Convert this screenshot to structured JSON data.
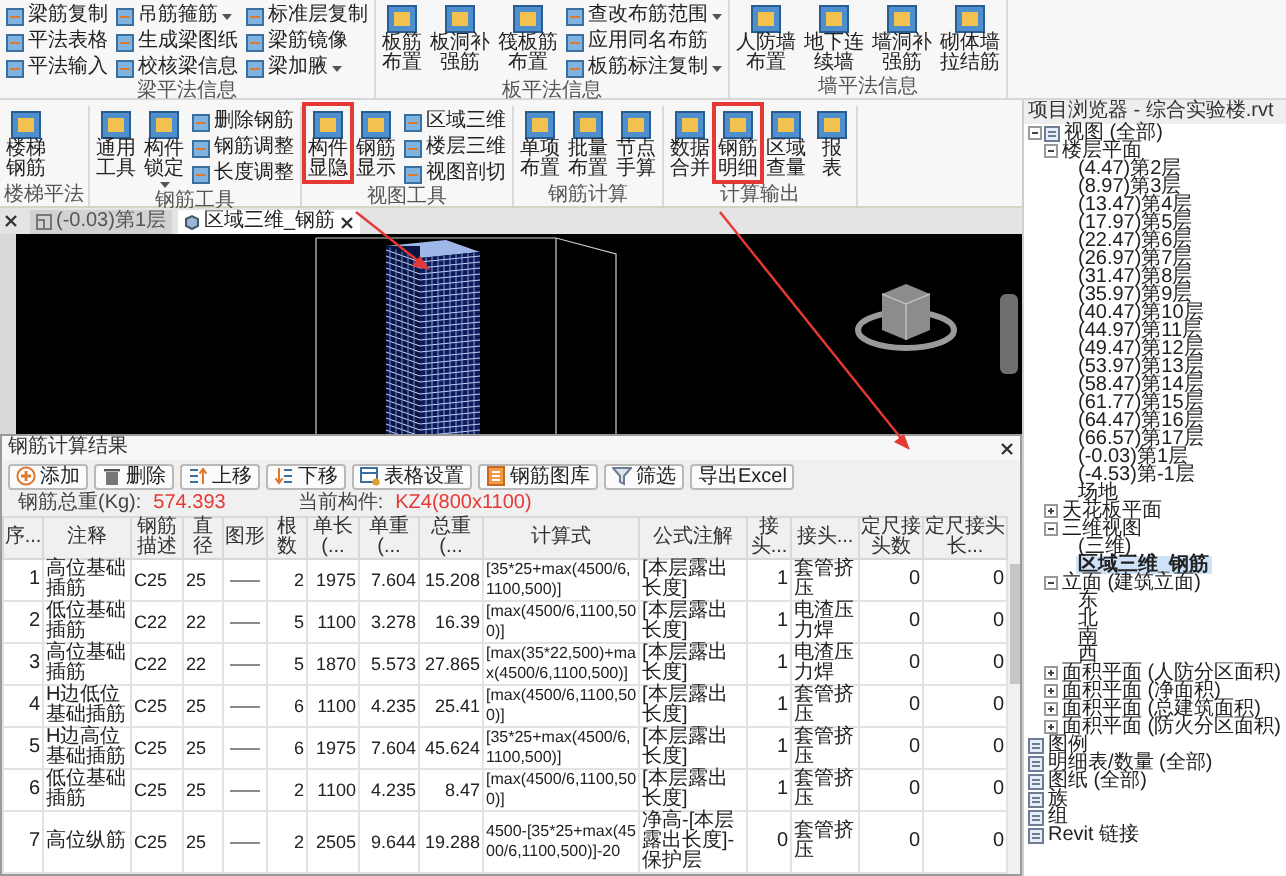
{
  "ribbon": {
    "groups": [
      {
        "label": "梁平法信息",
        "items": [
          {
            "label": "梁筋复制",
            "kind": "small",
            "dropdown": false,
            "highlighted": false
          },
          {
            "label": "平法表格",
            "kind": "small",
            "dropdown": false,
            "highlighted": false
          },
          {
            "label": "平法输入",
            "kind": "small",
            "dropdown": false,
            "highlighted": false
          },
          {
            "label": "吊筋箍筋",
            "kind": "small",
            "dropdown": true,
            "highlighted": false
          },
          {
            "label": "生成梁图纸",
            "kind": "small",
            "dropdown": false,
            "highlighted": false
          },
          {
            "label": "校核梁信息",
            "kind": "small",
            "dropdown": false,
            "highlighted": false
          },
          {
            "label": "标准层复制",
            "kind": "small",
            "dropdown": false,
            "highlighted": false
          },
          {
            "label": "梁筋镜像",
            "kind": "small",
            "dropdown": false,
            "highlighted": false
          },
          {
            "label": "梁加腋",
            "kind": "small",
            "dropdown": true,
            "highlighted": false
          }
        ]
      },
      {
        "label": "板平法信息",
        "items": [
          {
            "label": "板筋布置",
            "kind": "large",
            "dropdown": false,
            "highlighted": false
          },
          {
            "label": "板洞补强筋",
            "kind": "large",
            "dropdown": false,
            "highlighted": false
          },
          {
            "label": "筏板筋布置",
            "kind": "large",
            "dropdown": false,
            "highlighted": false
          },
          {
            "label": "查改布筋范围",
            "kind": "small",
            "dropdown": true,
            "highlighted": false
          },
          {
            "label": "应用同名布筋",
            "kind": "small",
            "dropdown": false,
            "highlighted": false
          },
          {
            "label": "板筋标注复制",
            "kind": "small",
            "dropdown": true,
            "highlighted": false
          }
        ]
      },
      {
        "label": "墙平法信息",
        "items": [
          {
            "label": "人防墙布置",
            "kind": "large",
            "dropdown": false,
            "highlighted": false
          },
          {
            "label": "地下连续墙",
            "kind": "large",
            "dropdown": false,
            "highlighted": false
          },
          {
            "label": "墙洞补强筋",
            "kind": "large",
            "dropdown": false,
            "highlighted": false
          },
          {
            "label": "砌体墙拉结筋",
            "kind": "large",
            "dropdown": false,
            "highlighted": false
          }
        ]
      },
      {
        "label": "楼梯平法",
        "items": [
          {
            "label": "楼梯钢筋",
            "kind": "large",
            "dropdown": false,
            "highlighted": false
          }
        ]
      },
      {
        "label": "钢筋工具",
        "items": [
          {
            "label": "通用工具",
            "kind": "large",
            "dropdown": false,
            "highlighted": false
          },
          {
            "label": "构件锁定",
            "kind": "large",
            "dropdown": true,
            "highlighted": false
          },
          {
            "label": "删除钢筋",
            "kind": "small",
            "dropdown": false,
            "highlighted": false
          },
          {
            "label": "钢筋调整",
            "kind": "small",
            "dropdown": false,
            "highlighted": false
          },
          {
            "label": "长度调整",
            "kind": "small",
            "dropdown": false,
            "highlighted": false
          }
        ]
      },
      {
        "label": "视图工具",
        "items": [
          {
            "label": "构件显隐",
            "kind": "large",
            "dropdown": false,
            "highlighted": true
          },
          {
            "label": "钢筋显示",
            "kind": "large",
            "dropdown": false,
            "highlighted": false
          },
          {
            "label": "区域三维",
            "kind": "small",
            "dropdown": false,
            "highlighted": false
          },
          {
            "label": "楼层三维",
            "kind": "small",
            "dropdown": false,
            "highlighted": false
          },
          {
            "label": "视图剖切",
            "kind": "small",
            "dropdown": false,
            "highlighted": false
          }
        ]
      },
      {
        "label": "钢筋计算",
        "items": [
          {
            "label": "单项布置",
            "kind": "large",
            "dropdown": false,
            "highlighted": false
          },
          {
            "label": "批量布置",
            "kind": "large",
            "dropdown": false,
            "highlighted": false
          },
          {
            "label": "节点手算",
            "kind": "large",
            "dropdown": false,
            "highlighted": false
          }
        ]
      },
      {
        "label": "计算输出",
        "items": [
          {
            "label": "数据合并",
            "kind": "large",
            "dropdown": false,
            "highlighted": false
          },
          {
            "label": "钢筋明细",
            "kind": "large",
            "dropdown": false,
            "highlighted": true
          },
          {
            "label": "区域查量",
            "kind": "large",
            "dropdown": false,
            "highlighted": false
          },
          {
            "label": "报表",
            "kind": "large",
            "dropdown": false,
            "highlighted": false
          }
        ]
      }
    ]
  },
  "tabs": [
    {
      "label": "(-0.03)第1层",
      "selected": false
    },
    {
      "label": "区域三维_钢筋",
      "selected": true
    }
  ],
  "browser": {
    "title": "项目浏览器 - 综合实验楼.rvt",
    "items": [
      {
        "label": "视图 (全部)",
        "selected": false,
        "expanded": true,
        "children": [
          {
            "label": "楼层平面",
            "selected": false,
            "expanded": true,
            "children": [
              {
                "label": "(4.47)第2层",
                "selected": false
              },
              {
                "label": "(8.97)第3层",
                "selected": false
              },
              {
                "label": "(13.47)第4层",
                "selected": false
              },
              {
                "label": "(17.97)第5层",
                "selected": false
              },
              {
                "label": "(22.47)第6层",
                "selected": false
              },
              {
                "label": "(26.97)第7层",
                "selected": false
              },
              {
                "label": "(31.47)第8层",
                "selected": false
              },
              {
                "label": "(35.97)第9层",
                "selected": false
              },
              {
                "label": "(40.47)第10层",
                "selected": false
              },
              {
                "label": "(44.97)第11层",
                "selected": false
              },
              {
                "label": "(49.47)第12层",
                "selected": false
              },
              {
                "label": "(53.97)第13层",
                "selected": false
              },
              {
                "label": "(58.47)第14层",
                "selected": false
              },
              {
                "label": "(61.77)第15层",
                "selected": false
              },
              {
                "label": "(64.47)第16层",
                "selected": false
              },
              {
                "label": "(66.57)第17层",
                "selected": false
              },
              {
                "label": "(-0.03)第1层",
                "selected": false
              },
              {
                "label": "(-4.53)第-1层",
                "selected": false
              },
              {
                "label": "场地",
                "selected": false
              }
            ]
          },
          {
            "label": "天花板平面",
            "selected": false,
            "expanded": false
          },
          {
            "label": "三维视图",
            "selected": false,
            "expanded": true,
            "children": [
              {
                "label": "(三维)",
                "selected": false
              },
              {
                "label": "区域三维_钢筋",
                "selected": true
              }
            ]
          },
          {
            "label": "立面 (建筑立面)",
            "selected": false,
            "expanded": true,
            "children": [
              {
                "label": "东",
                "selected": false
              },
              {
                "label": "北",
                "selected": false
              },
              {
                "label": "南",
                "selected": false
              },
              {
                "label": "西",
                "selected": false
              }
            ]
          },
          {
            "label": "面积平面 (人防分区面积)",
            "selected": false,
            "expanded": false
          },
          {
            "label": "面积平面 (净面积)",
            "selected": false,
            "expanded": false
          },
          {
            "label": "面积平面 (总建筑面积)",
            "selected": false,
            "expanded": false
          },
          {
            "label": "面积平面 (防火分区面积)",
            "selected": false,
            "expanded": false
          }
        ]
      },
      {
        "label": "图例",
        "selected": false
      },
      {
        "label": "明细表/数量 (全部)",
        "selected": false
      },
      {
        "label": "图纸 (全部)",
        "selected": false
      },
      {
        "label": "族",
        "selected": false
      },
      {
        "label": "组",
        "selected": false
      },
      {
        "label": "Revit 链接",
        "selected": false
      }
    ]
  },
  "dialog": {
    "title": "钢筋计算结果",
    "buttons": [
      "添加",
      "删除",
      "上移",
      "下移",
      "表格设置",
      "钢筋图库",
      "筛选",
      "导出Excel"
    ],
    "total_label": "钢筋总重(Kg):",
    "total_value": "574.393",
    "component_label": "当前构件:",
    "component_value": "KZ4(800x1100)",
    "columns": [
      "序...",
      "注释",
      "钢筋描述",
      "直径",
      "图形",
      "根数",
      "单长(...",
      "单重(...",
      "总重(...",
      "计算式",
      "公式注解",
      "接头...",
      "接头...",
      "定尺接头数",
      "定尺接头长..."
    ],
    "rows": [
      [
        "1",
        "高位基础插筋",
        "C25",
        "25",
        "",
        "2",
        "1975",
        "7.604",
        "15.208",
        "[35*25+max(4500/6,1100,500)]",
        "[本层露出长度]",
        "1",
        "套管挤压",
        "0",
        "0"
      ],
      [
        "2",
        "低位基础插筋",
        "C22",
        "22",
        "",
        "5",
        "1100",
        "3.278",
        "16.39",
        "[max(4500/6,1100,500)]",
        "[本层露出长度]",
        "1",
        "电渣压力焊",
        "0",
        "0"
      ],
      [
        "3",
        "高位基础插筋",
        "C22",
        "22",
        "",
        "5",
        "1870",
        "5.573",
        "27.865",
        "[max(35*22,500)+max(4500/6,1100,500)]",
        "[本层露出长度]",
        "1",
        "电渣压力焊",
        "0",
        "0"
      ],
      [
        "4",
        "H边低位基础插筋",
        "C25",
        "25",
        "",
        "6",
        "1100",
        "4.235",
        "25.41",
        "[max(4500/6,1100,500)]",
        "[本层露出长度]",
        "1",
        "套管挤压",
        "0",
        "0"
      ],
      [
        "5",
        "H边高位基础插筋",
        "C25",
        "25",
        "",
        "6",
        "1975",
        "7.604",
        "45.624",
        "[35*25+max(4500/6,1100,500)]",
        "[本层露出长度]",
        "1",
        "套管挤压",
        "0",
        "0"
      ],
      [
        "6",
        "低位基础插筋",
        "C25",
        "25",
        "",
        "2",
        "1100",
        "4.235",
        "8.47",
        "[max(4500/6,1100,500)]",
        "[本层露出长度]",
        "1",
        "套管挤压",
        "0",
        "0"
      ],
      [
        "7",
        "高位纵筋",
        "C25",
        "25",
        "",
        "2",
        "2505",
        "9.644",
        "19.288",
        "4500-[35*25+max(4500/6,1100,500)]-20",
        "净高-[本层露出长度]-保护层",
        "0",
        "套管挤压",
        "0",
        "0"
      ]
    ]
  }
}
